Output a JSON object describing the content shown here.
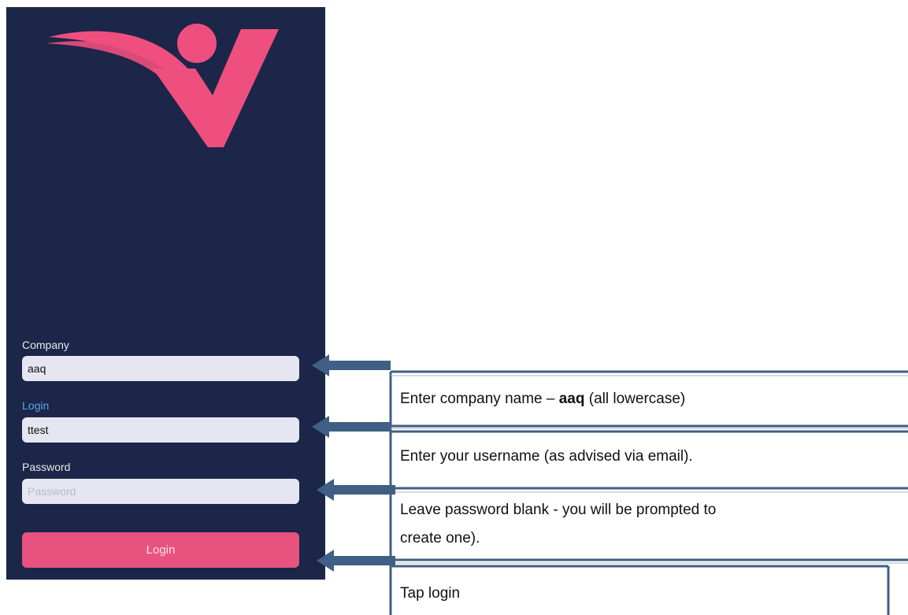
{
  "login_form": {
    "company": {
      "label": "Company",
      "value": "aaq"
    },
    "login": {
      "label": "Login",
      "value": "ttest"
    },
    "password": {
      "label": "Password",
      "placeholder": "Password",
      "value": ""
    },
    "submit_label": "Login"
  },
  "annotations": {
    "company_prefix": "Enter company name – ",
    "company_value": "aaq",
    "company_suffix": " (all lowercase)",
    "username": "Enter your username (as advised via email).",
    "password_line1": "Leave password blank - you will be prompted to",
    "password_line2": "create one).",
    "login": "Tap login"
  },
  "colors": {
    "panel_background": "#1b2648",
    "brand_pink": "#ef4f7e",
    "field_background": "#e5e6f2",
    "active_label": "#5aa6e8",
    "callout_border": "#3f5f84"
  },
  "icons": [
    "brand-logo-icon",
    "arrow-left-icon"
  ]
}
